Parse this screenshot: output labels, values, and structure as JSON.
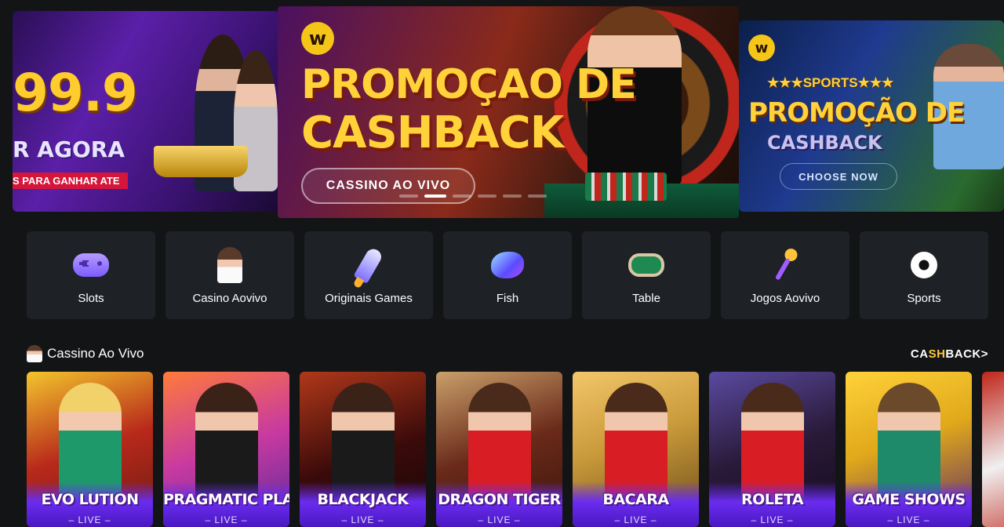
{
  "banners": {
    "left": {
      "amount": "99.9",
      "cta": "R AGORA",
      "ribbon": "S PARA GANHAR ATE"
    },
    "main": {
      "logo": "w",
      "title_line1": "PROMOÇAO DE",
      "title_line2": "CASHBACK",
      "button": "CASSINO AO VIVO",
      "active_dot": 1
    },
    "right": {
      "logo": "w",
      "tag": "★★★SPORTS★★★",
      "title": "PROMOÇÃO DE",
      "subtitle": "CASHBACK",
      "button": "CHOOSE NOW"
    }
  },
  "categories": [
    {
      "label": "Slots",
      "icon": "gamepad-icon"
    },
    {
      "label": "Casino Aovivo",
      "icon": "dealer-icon"
    },
    {
      "label": "Originais Games",
      "icon": "rocket-icon"
    },
    {
      "label": "Fish",
      "icon": "fish-icon"
    },
    {
      "label": "Table",
      "icon": "card-table-icon"
    },
    {
      "label": "Jogos Aovivo",
      "icon": "microphone-icon"
    },
    {
      "label": "Sports",
      "icon": "soccer-ball-icon"
    }
  ],
  "section": {
    "title": "Cassino Ao Vivo",
    "link_pre": "CA",
    "link_hl": "SH",
    "link_post": "BACK>"
  },
  "games": [
    {
      "label": "EVO LUTION",
      "status": "– LIVE –"
    },
    {
      "label": "PRAGMATIC PLAY",
      "status": "– LIVE –"
    },
    {
      "label": "BLACKJACK",
      "status": "– LIVE –"
    },
    {
      "label": "DRAGON TIGER",
      "status": "– LIVE –"
    },
    {
      "label": "BACARA",
      "status": "– LIVE –"
    },
    {
      "label": "ROLETA",
      "status": "– LIVE –"
    },
    {
      "label": "GAME SHOWS",
      "status": "– LIVE –"
    }
  ]
}
